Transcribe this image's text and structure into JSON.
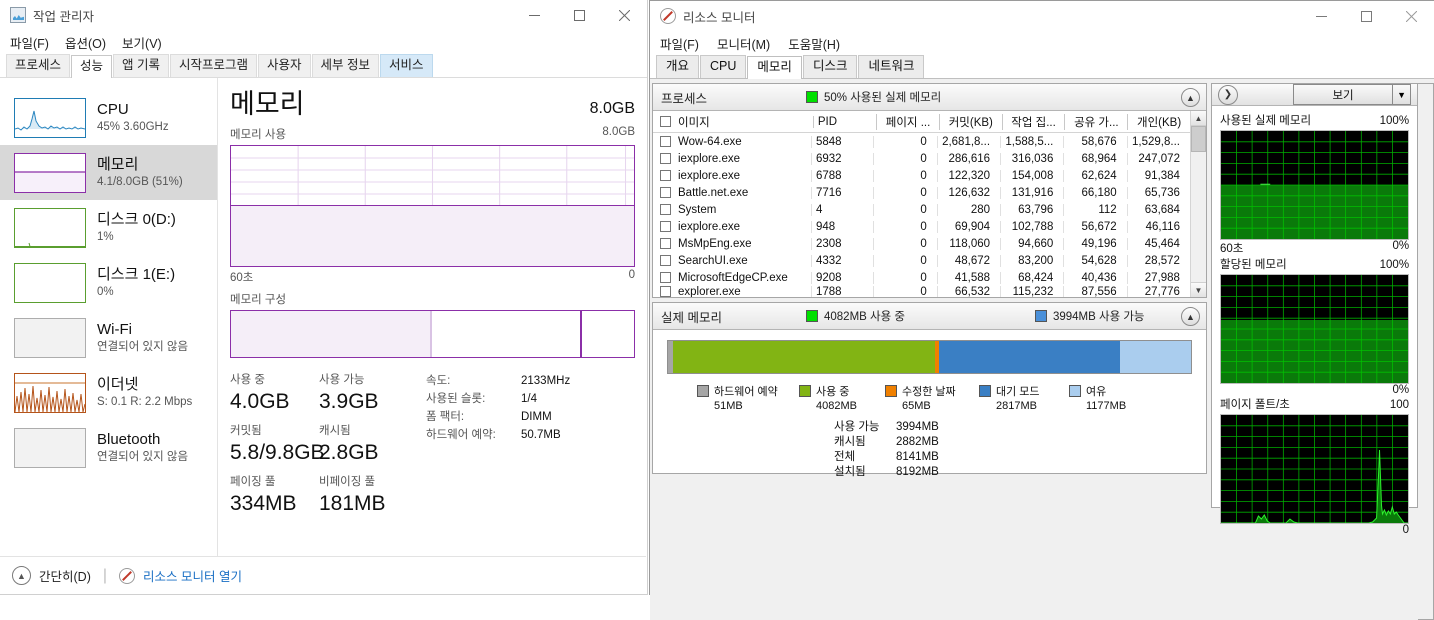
{
  "taskmanager": {
    "title": "작업 관리자",
    "title_icon": "task-manager-icon",
    "window_controls": {
      "minimize": "−",
      "maximize": "□",
      "close": "✕"
    },
    "menu": [
      "파일(F)",
      "옵션(O)",
      "보기(V)"
    ],
    "tabs": [
      "프로세스",
      "성능",
      "앱 기록",
      "시작프로그램",
      "사용자",
      "세부 정보",
      "서비스"
    ],
    "active_tab": "성능",
    "highlighted_tab": "서비스",
    "sidebar": [
      {
        "name": "CPU",
        "sub": "45% 3.60GHz",
        "graph": "cpu",
        "selected": false
      },
      {
        "name": "메모리",
        "sub": "4.1/8.0GB (51%)",
        "graph": "memory",
        "selected": true
      },
      {
        "name": "디스크 0(D:)",
        "sub": "1%",
        "graph": "disk",
        "selected": false
      },
      {
        "name": "디스크 1(E:)",
        "sub": "0%",
        "graph": "disk",
        "selected": false
      },
      {
        "name": "Wi-Fi",
        "sub": "연결되어 있지 않음",
        "graph": "blank",
        "selected": false
      },
      {
        "name": "이더넷",
        "sub": "S: 0.1 R: 2.2 Mbps",
        "graph": "ethernet",
        "selected": false
      },
      {
        "name": "Bluetooth",
        "sub": "연결되어 있지 않음",
        "graph": "blank",
        "selected": false
      }
    ],
    "main": {
      "heading": "메모리",
      "total": "8.0GB",
      "graph_label": "메모리 사용",
      "graph_max": "8.0GB",
      "graph_time_left": "60초",
      "graph_time_right": "0",
      "composition_label": "메모리 구성",
      "stats": {
        "in_use_cap": "사용 중",
        "in_use_val": "4.0GB",
        "available_cap": "사용 가능",
        "available_val": "3.9GB",
        "committed_cap": "커밋됨",
        "committed_val": "5.8/9.8GB",
        "cached_cap": "캐시됨",
        "cached_val": "2.8GB",
        "paged_cap": "페이징 풀",
        "paged_val": "334MB",
        "nonpaged_cap": "비페이징 풀",
        "nonpaged_val": "181MB"
      },
      "specs": [
        {
          "key": "속도:",
          "value": "2133MHz"
        },
        {
          "key": "사용된 슬롯:",
          "value": "1/4"
        },
        {
          "key": "폼 팩터:",
          "value": "DIMM"
        },
        {
          "key": "하드웨어 예약:",
          "value": "50.7MB"
        }
      ]
    },
    "statusbar": {
      "fewer_details": "간단히(D)",
      "open_resource_monitor": "리소스 모니터 열기"
    }
  },
  "resourcemonitor": {
    "title": "리소스 모니터",
    "window_controls": {
      "minimize": "−",
      "maximize": "□",
      "close": "✕"
    },
    "menu": [
      "파일(F)",
      "모니터(M)",
      "도움말(H)"
    ],
    "tabs": [
      "개요",
      "CPU",
      "메모리",
      "디스크",
      "네트워크"
    ],
    "active_tab": "메모리",
    "processes_panel": {
      "title": "프로세스",
      "status": "50% 사용된 실제 메모리",
      "columns": [
        "이미지",
        "PID",
        "페이지 ...",
        "커밋(KB)",
        "작업 집...",
        "공유 가...",
        "개인(KB)"
      ],
      "rows": [
        {
          "image": "Wow-64.exe",
          "pid": "5848",
          "hardfault": "0",
          "commit": "2,681,8...",
          "working": "1,588,5...",
          "shareable": "58,676",
          "private": "1,529,8..."
        },
        {
          "image": "iexplore.exe",
          "pid": "6932",
          "hardfault": "0",
          "commit": "286,616",
          "working": "316,036",
          "shareable": "68,964",
          "private": "247,072"
        },
        {
          "image": "iexplore.exe",
          "pid": "6788",
          "hardfault": "0",
          "commit": "122,320",
          "working": "154,008",
          "shareable": "62,624",
          "private": "91,384"
        },
        {
          "image": "Battle.net.exe",
          "pid": "7716",
          "hardfault": "0",
          "commit": "126,632",
          "working": "131,916",
          "shareable": "66,180",
          "private": "65,736"
        },
        {
          "image": "System",
          "pid": "4",
          "hardfault": "0",
          "commit": "280",
          "working": "63,796",
          "shareable": "112",
          "private": "63,684"
        },
        {
          "image": "iexplore.exe",
          "pid": "948",
          "hardfault": "0",
          "commit": "69,904",
          "working": "102,788",
          "shareable": "56,672",
          "private": "46,116"
        },
        {
          "image": "MsMpEng.exe",
          "pid": "2308",
          "hardfault": "0",
          "commit": "118,060",
          "working": "94,660",
          "shareable": "49,196",
          "private": "45,464"
        },
        {
          "image": "SearchUI.exe",
          "pid": "4332",
          "hardfault": "0",
          "commit": "48,672",
          "working": "83,200",
          "shareable": "54,628",
          "private": "28,572"
        },
        {
          "image": "MicrosoftEdgeCP.exe",
          "pid": "9208",
          "hardfault": "0",
          "commit": "41,588",
          "working": "68,424",
          "shareable": "40,436",
          "private": "27,988"
        },
        {
          "image": "explorer.exe",
          "pid": "1788",
          "hardfault": "0",
          "commit": "66,532",
          "working": "115,232",
          "shareable": "87,556",
          "private": "27,776"
        }
      ]
    },
    "physical_panel": {
      "title": "실제 메모리",
      "status_used": "4082MB 사용 중",
      "status_available": "3994MB 사용 가능",
      "legend": [
        {
          "label": "하드웨어 예약",
          "value": "51MB",
          "color": "#a6a6a6"
        },
        {
          "label": "사용 중",
          "value": "4082MB",
          "color": "#82b414"
        },
        {
          "label": "수정한 날짜",
          "value": "65MB",
          "color": "#f08000"
        },
        {
          "label": "대기 모드",
          "value": "2817MB",
          "color": "#3a7fc4"
        },
        {
          "label": "여유",
          "value": "1177MB",
          "color": "#aacdee"
        }
      ],
      "summary": [
        {
          "key": "사용 가능",
          "value": "3994MB"
        },
        {
          "key": "캐시됨",
          "value": "2882MB"
        },
        {
          "key": "전체",
          "value": "8141MB"
        },
        {
          "key": "설치됨",
          "value": "8192MB"
        }
      ]
    },
    "right_panel": {
      "view_button": "보기",
      "graphs": [
        {
          "title": "사용된 실제 메모리",
          "max": "100%",
          "min": "0%",
          "time": "60초",
          "fill_pct": 50,
          "spike": false
        },
        {
          "title": "할당된 메모리",
          "max": "100%",
          "min": "0%",
          "time": "",
          "fill_pct": 58,
          "spike": false
        },
        {
          "title": "페이지 폴트/초",
          "max": "100",
          "min": "0",
          "time": "",
          "fill_pct": 0,
          "spike": true
        }
      ]
    }
  },
  "chart_data": [
    {
      "type": "area",
      "title": "메모리 사용",
      "ylabel": "",
      "xlabel": "",
      "ylim": [
        0,
        8.0
      ],
      "ytick_label": "8.0GB",
      "xtick_labels": [
        "60초",
        "0"
      ],
      "series": [
        {
          "name": "메모리 사용",
          "constant_value": 4.1,
          "percent": 51
        }
      ],
      "grid": true,
      "color": "#8b2fa8"
    },
    {
      "type": "bar",
      "title": "메모리 구성",
      "categories": [
        "사용 중",
        "대기 모드",
        "여유"
      ],
      "values": [
        4082,
        2817,
        1177
      ],
      "unit": "MB",
      "grid": false,
      "color": "#8b2fa8"
    },
    {
      "type": "bar",
      "title": "실제 메모리",
      "categories": [
        "하드웨어 예약",
        "사용 중",
        "수정한 날짜",
        "대기 모드",
        "여유"
      ],
      "values": [
        51,
        4082,
        65,
        2817,
        1177
      ],
      "unit": "MB",
      "colors": [
        "#a6a6a6",
        "#82b414",
        "#f08000",
        "#3a7fc4",
        "#aacdee"
      ],
      "total": 8192,
      "grid": false
    },
    {
      "type": "area",
      "title": "사용된 실제 메모리",
      "ylim": [
        0,
        100
      ],
      "ylabel": "%",
      "xtick_labels": [
        "60초",
        ""
      ],
      "values": [
        50
      ],
      "grid": true,
      "color": "#0a7a0a"
    },
    {
      "type": "area",
      "title": "할당된 메모리",
      "ylim": [
        0,
        100
      ],
      "ylabel": "%",
      "values": [
        58
      ],
      "grid": true,
      "color": "#0a7a0a"
    },
    {
      "type": "line",
      "title": "페이지 폴트/초",
      "ylim": [
        0,
        100
      ],
      "values": [
        0,
        0,
        0,
        0,
        2,
        3,
        2,
        0,
        0,
        1,
        1,
        0,
        0,
        0,
        0,
        0,
        0,
        85,
        60,
        12
      ],
      "grid": true,
      "color": "#2ef22e"
    }
  ]
}
